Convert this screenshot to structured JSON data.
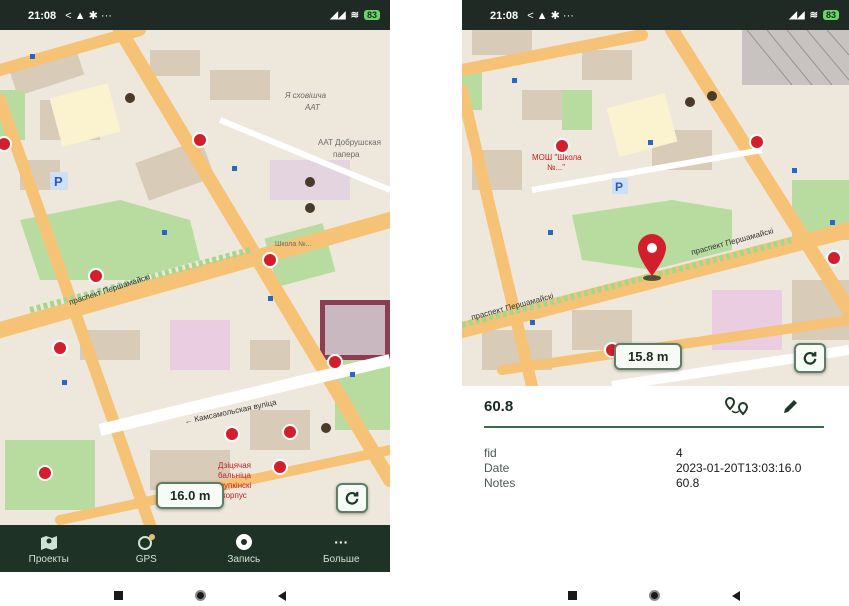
{
  "left_screen": {
    "status": {
      "time": "21:08",
      "icons_left": "< ▲ ✱ ···",
      "battery": "83"
    },
    "map_labels": {
      "bsssr_aat": "Я сховішча\nААТ",
      "dobrush_paper": "ААТ Добрушская\nпапера",
      "perv_street": "праспект Першамайскі",
      "komsomol": "Камсамольская вуліца",
      "hospital": "Дзіцячая\nбальніца\nКрупкінскі\nкорпус",
      "school_left": "Школа\n№",
      "nav_line": "← Кансамольская вуліца"
    },
    "scale": "16.0 m",
    "bottom_nav": [
      {
        "label": "Проекты",
        "icon": "projects-icon"
      },
      {
        "label": "GPS",
        "icon": "gps-icon"
      },
      {
        "label": "Запись",
        "icon": "record-icon"
      },
      {
        "label": "Больше",
        "icon": "more-icon"
      }
    ]
  },
  "right_screen": {
    "status": {
      "time": "21:08",
      "icons_left": "< ▲ ✱ ···",
      "battery": "83"
    },
    "map_labels": {
      "school": "МОШ \"Школа\n№...\"",
      "perv_street": "праспект Першамайскі"
    },
    "scale": "15.8 m",
    "feature": {
      "title": "60.8",
      "attributes": [
        {
          "key": "fid",
          "value": "4"
        },
        {
          "key": "Date",
          "value": "2023-01-20T13:03:16.0"
        },
        {
          "key": "Notes",
          "value": "60.8"
        }
      ]
    }
  },
  "colors": {
    "map_bg": "#eee8dc",
    "road": "#f6c276",
    "park": "#b8dca0",
    "building": "#d8cbb8",
    "nav_bg": "#1f3226",
    "accent": "#3a6a4a",
    "pin": "#d21f2b"
  }
}
